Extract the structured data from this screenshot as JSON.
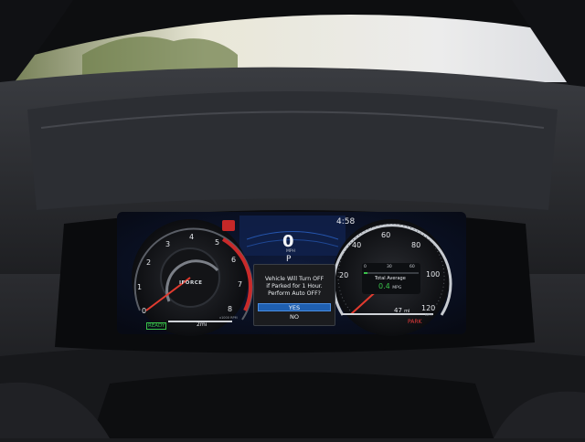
{
  "display": {
    "clock": "4:58",
    "speed_value": "0",
    "speed_unit": "MPH",
    "gear": "P",
    "park_label": "PARK",
    "ready_label": "READY",
    "range_value": "47",
    "range_unit": "mi",
    "trip_distance": "2",
    "trip_unit": "mi",
    "brand_logo": "IFORCE"
  },
  "tachometer": {
    "ticks": [
      "0",
      "1",
      "2",
      "3",
      "4",
      "5",
      "6",
      "7",
      "8"
    ],
    "unit": "x1000 RPM"
  },
  "speedometer": {
    "ticks": [
      "20",
      "40",
      "60",
      "80",
      "100",
      "120"
    ],
    "unit": "MPH"
  },
  "fuel_economy": {
    "scale": [
      "0",
      "30",
      "60"
    ],
    "label": "Total Average",
    "value": "0.4",
    "unit": "MPG"
  },
  "dialog": {
    "line1": "Vehicle Will Turn OFF",
    "line2": "if Parked for 1 Hour.",
    "line3": "Perform Auto OFF?",
    "yes_label": "YES",
    "no_label": "NO"
  },
  "colors": {
    "accent_blue": "#1f5fb0",
    "ready_green": "#39c24a",
    "park_red": "#e33a3a",
    "needle_red": "#e23b2f"
  }
}
